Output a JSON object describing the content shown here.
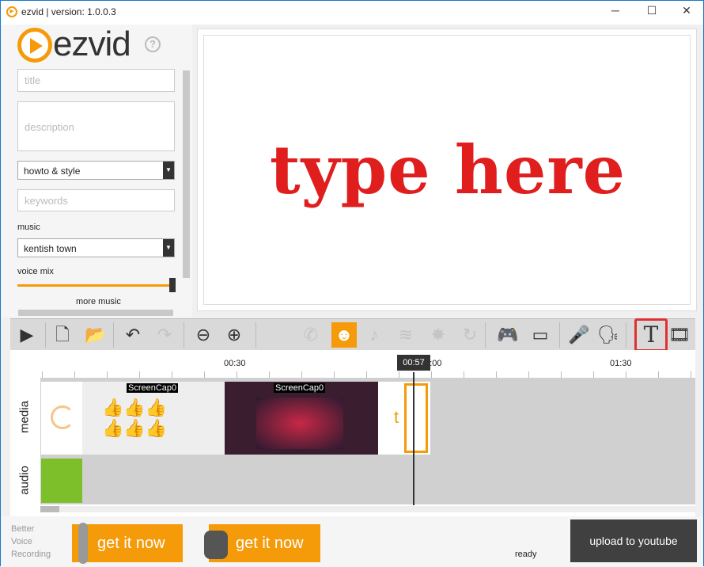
{
  "window": {
    "title": "ezvid | version: 1.0.0.3",
    "minimize": "─",
    "maximize": "☐",
    "close": "✕"
  },
  "brand": {
    "logo": "ezvid",
    "help": "?"
  },
  "form": {
    "title_placeholder": "title",
    "description_placeholder": "description",
    "category": "howto & style",
    "keywords_placeholder": "keywords",
    "music_label": "music",
    "music": "kentish town",
    "voice_mix_label": "voice mix",
    "voice_mix_level": 1.0,
    "more_music": "more music"
  },
  "preview": {
    "text": "type here",
    "text_color": "#e01e1e"
  },
  "toolbar": {
    "items": [
      {
        "name": "play",
        "icon": "▶"
      },
      {
        "name": "new-project",
        "icon": "🗋"
      },
      {
        "name": "open-folder",
        "icon": "📂"
      },
      {
        "name": "undo",
        "icon": "↶"
      },
      {
        "name": "redo",
        "icon": "↷"
      },
      {
        "name": "zoom-out",
        "icon": "⊖"
      },
      {
        "name": "zoom-in",
        "icon": "⊕"
      },
      {
        "name": "phone",
        "icon": "✆"
      },
      {
        "name": "robot",
        "icon": "☻"
      },
      {
        "name": "guitar",
        "icon": "♪"
      },
      {
        "name": "waves",
        "icon": "≋"
      },
      {
        "name": "burst",
        "icon": "✸"
      },
      {
        "name": "spiral",
        "icon": "↻"
      },
      {
        "name": "gamepad",
        "icon": "🎮"
      },
      {
        "name": "monitor",
        "icon": "▭"
      },
      {
        "name": "microphone",
        "icon": "🎤"
      },
      {
        "name": "speech",
        "icon": "🗣"
      },
      {
        "name": "text",
        "icon": "T"
      },
      {
        "name": "film",
        "icon": "🎞"
      }
    ],
    "accent": "#f59b0a",
    "highlight": "#e03030"
  },
  "timeline": {
    "ticks": [
      "00:30",
      "01:00",
      "01:30"
    ],
    "playhead": "00:57",
    "tracks": [
      "media",
      "audio"
    ],
    "clips": [
      "ScreenCap0",
      "ScreenCap0"
    ],
    "text_clip": "t"
  },
  "bottom": {
    "promo": [
      "Better",
      "Voice",
      "Recording"
    ],
    "ad1": "get it now",
    "ad2": "get it now",
    "status": "ready",
    "upload": "upload to youtube"
  }
}
